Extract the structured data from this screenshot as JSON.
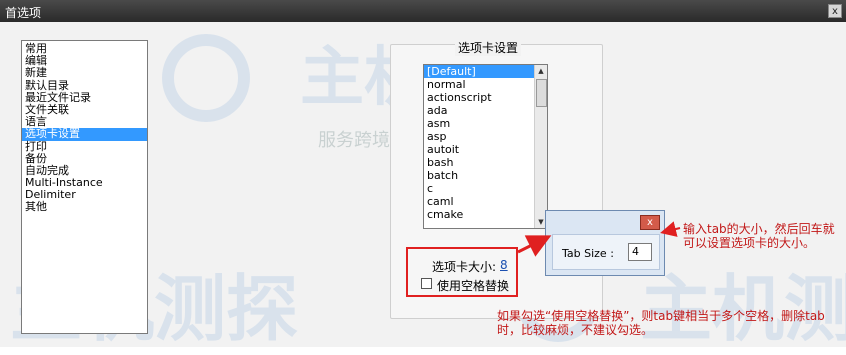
{
  "window": {
    "title": "首选项",
    "close_glyph": "x"
  },
  "watermark": {
    "brand": "主机测探",
    "slogan": "服务跨境电商 助力中企出海"
  },
  "categories": {
    "items": [
      {
        "label": "常用"
      },
      {
        "label": "编辑"
      },
      {
        "label": "新建"
      },
      {
        "label": "默认目录"
      },
      {
        "label": "最近文件记录"
      },
      {
        "label": "文件关联"
      },
      {
        "label": "语言"
      },
      {
        "label": "选项卡设置"
      },
      {
        "label": "打印"
      },
      {
        "label": "备份"
      },
      {
        "label": "自动完成"
      },
      {
        "label": "Multi-Instance"
      },
      {
        "label": "Delimiter"
      },
      {
        "label": "其他"
      }
    ],
    "selected_index": 7
  },
  "tab_settings": {
    "group_title": "选项卡设置",
    "languages": [
      {
        "label": "[Default]"
      },
      {
        "label": "normal"
      },
      {
        "label": "actionscript"
      },
      {
        "label": "ada"
      },
      {
        "label": "asm"
      },
      {
        "label": "asp"
      },
      {
        "label": "autoit"
      },
      {
        "label": "bash"
      },
      {
        "label": "batch"
      },
      {
        "label": "c"
      },
      {
        "label": "caml"
      },
      {
        "label": "cmake"
      }
    ],
    "selected_language_index": 0,
    "size_label": "选项卡大小:",
    "size_value": "8",
    "replace_label": "使用空格替换",
    "replace_checked": false
  },
  "popup": {
    "close_glyph": "x",
    "field_label": "Tab Size :",
    "field_value": "4"
  },
  "annotations": {
    "note_tabsize": "输入tab的大小，然后回车就可以设置选项卡的大小。",
    "note_space": "如果勾选“使用空格替换”，则tab键相当于多个空格，删除tab时，比较麻烦，不建议勾选。"
  },
  "colors": {
    "selection": "#3399ff",
    "annotation_red": "#c21818",
    "titlebar": "#333333"
  }
}
